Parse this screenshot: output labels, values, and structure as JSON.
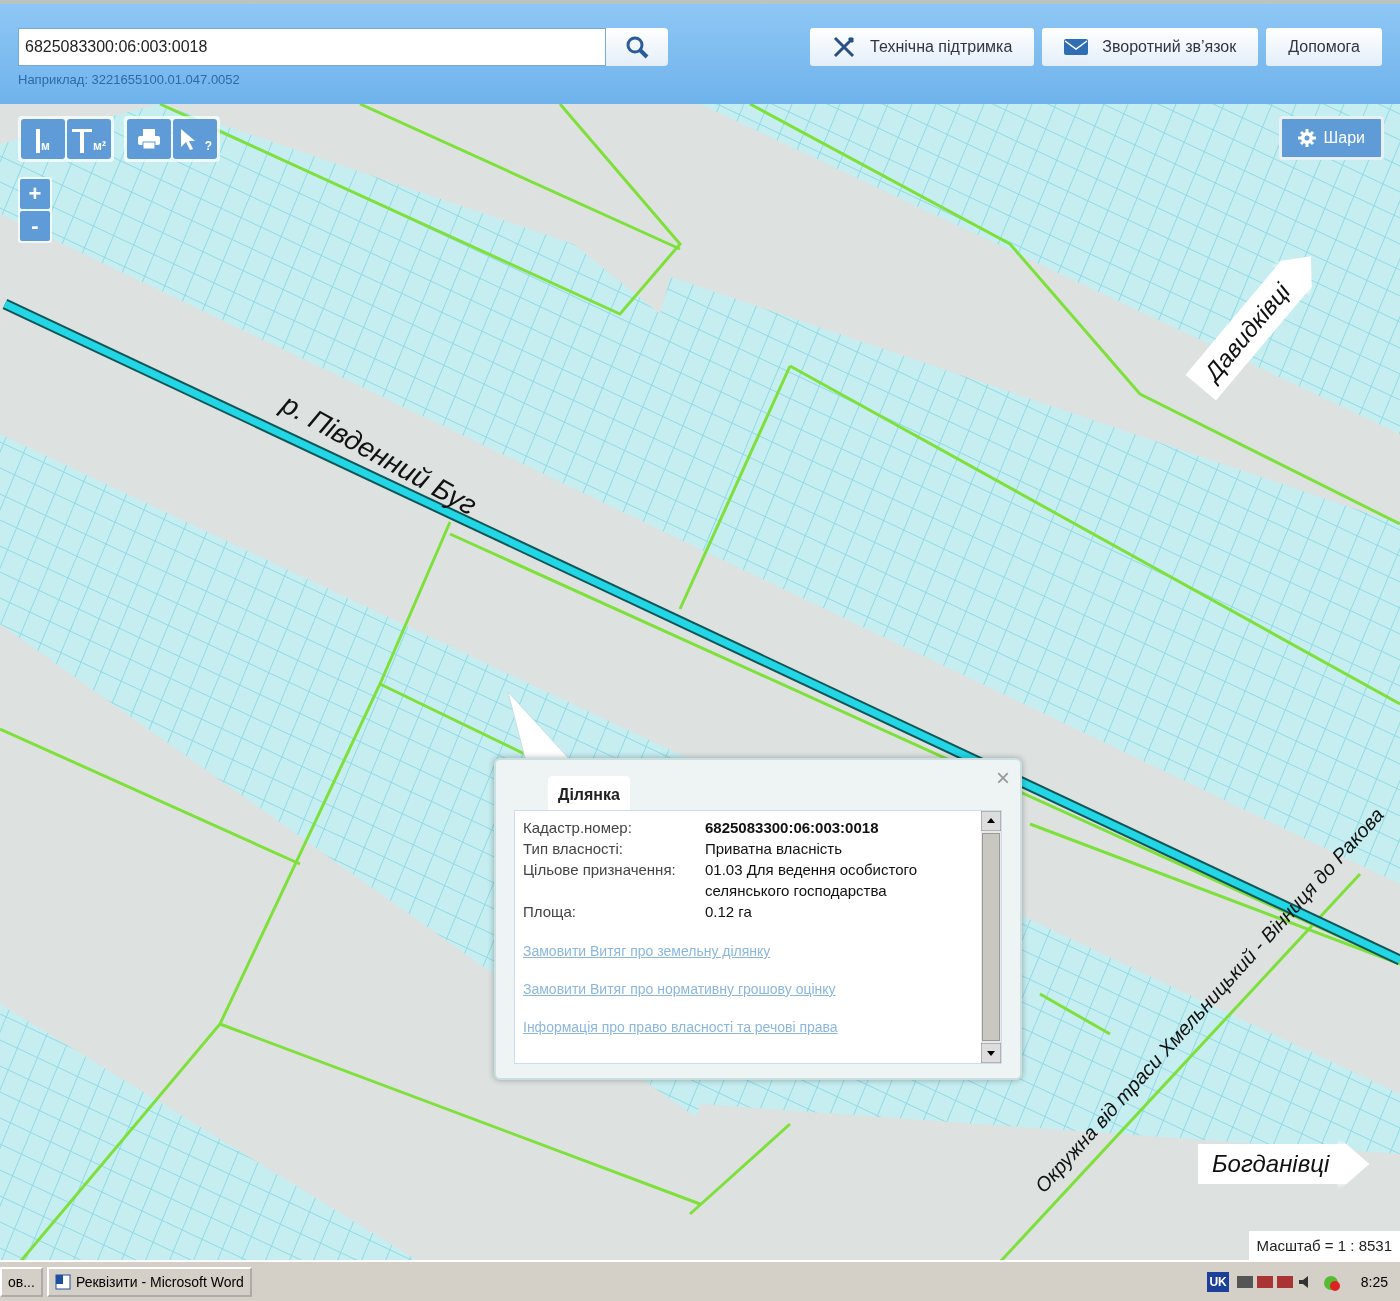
{
  "search": {
    "value": "6825083300:06:003:0018",
    "hint": "Наприклад: 3221655100.01.047.0052"
  },
  "header_buttons": [
    {
      "kind": "support",
      "label": "Технічна підтримка"
    },
    {
      "kind": "feedback",
      "label": "Зворотний зв’язок"
    },
    {
      "kind": "plain",
      "label": "Допомога"
    }
  ],
  "map_tools": [
    {
      "kind": "length",
      "unit": "м"
    },
    {
      "kind": "area",
      "unit": "м²"
    },
    {
      "kind": "print"
    },
    {
      "kind": "identify",
      "mark": "?"
    }
  ],
  "zoom": [
    "+",
    "-"
  ],
  "layers_button": "Шари",
  "map_labels": [
    {
      "kind": "river",
      "text": "р. Південний Буг"
    },
    {
      "kind": "road",
      "text": "Окружна від траси Хмельницький - Вінниця до Ракова"
    },
    {
      "kind": "arrow_ne",
      "text": "Давидківці"
    },
    {
      "kind": "arrow_e",
      "text": "Богданівці"
    }
  ],
  "popup": {
    "close": "×",
    "tabs": [
      {
        "label": "Ділянка",
        "selected": true
      }
    ],
    "fields": [
      {
        "label": "Кадастр.номер:",
        "value": "6825083300:06:003:0018",
        "bold": true
      },
      {
        "label": "Тип власності:",
        "value": "Приватна власність",
        "bold": false
      },
      {
        "label": "Цільове призначення:",
        "value": "01.03 Для ведення особистого селянського господарства",
        "bold": false
      },
      {
        "label": "Площа:",
        "value": "0.12 га",
        "bold": false
      }
    ],
    "links": [
      "Замовити Витяг про земельну ділянку",
      "Замовити Витяг про нормативну грошову оцінку",
      "Інформація про право власності та речові права"
    ]
  },
  "scale": "Масштаб = 1 : 8531",
  "taskbar": {
    "tasks": [
      {
        "kind": "folder",
        "label": "ов..."
      },
      {
        "kind": "word",
        "label": "Реквізити - Microsoft Word"
      }
    ],
    "language": "UK",
    "clock": "8:25"
  }
}
